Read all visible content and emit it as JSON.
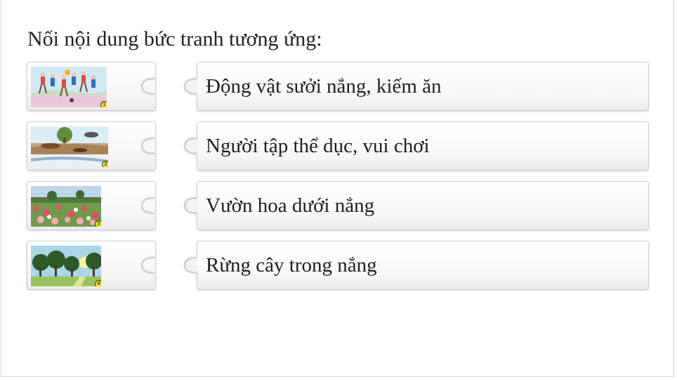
{
  "question": {
    "text": "Nối nội dung bức tranh tương ứng:"
  },
  "image_pieces": [
    {
      "icon": "children-playing-picture",
      "badge": "1"
    },
    {
      "icon": "animals-sunbathing-picture",
      "badge": "2"
    },
    {
      "icon": "flower-garden-picture",
      "badge": "3"
    },
    {
      "icon": "forest-sunlight-picture",
      "badge": "4"
    }
  ],
  "answers": [
    {
      "text": "Động vật sưởi nắng, kiếm ăn"
    },
    {
      "text": "Người tập thể dục, vui chơi"
    },
    {
      "text": "Vườn hoa dưới nắng"
    },
    {
      "text": "Rừng cây trong nắng"
    }
  ],
  "colors": {
    "piece_border": "#cfcfcf",
    "text": "#1f1f1f",
    "badge": "#f2e500"
  }
}
